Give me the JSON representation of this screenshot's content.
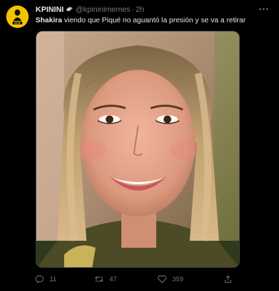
{
  "tweet": {
    "author": {
      "display_name": "KPININI",
      "handle": "@kpininimemes",
      "separator": "·",
      "time": "2h",
      "avatar_label": "KPIN"
    },
    "text_bold": "Shakira",
    "text_rest": " viendo que Piqué no aguantó la presión y se va a retirar",
    "media_icon": "photo",
    "metrics": {
      "replies": "11",
      "retweets": "47",
      "likes": "359"
    },
    "icons": {
      "more": "more-dots-icon",
      "reply": "reply-icon",
      "retweet": "retweet-icon",
      "like": "heart-icon",
      "share": "share-icon"
    }
  },
  "colors": {
    "background": "#000000",
    "text_primary": "#e7e9ea",
    "text_secondary": "#71767b",
    "avatar_bg": "#f3c300"
  }
}
